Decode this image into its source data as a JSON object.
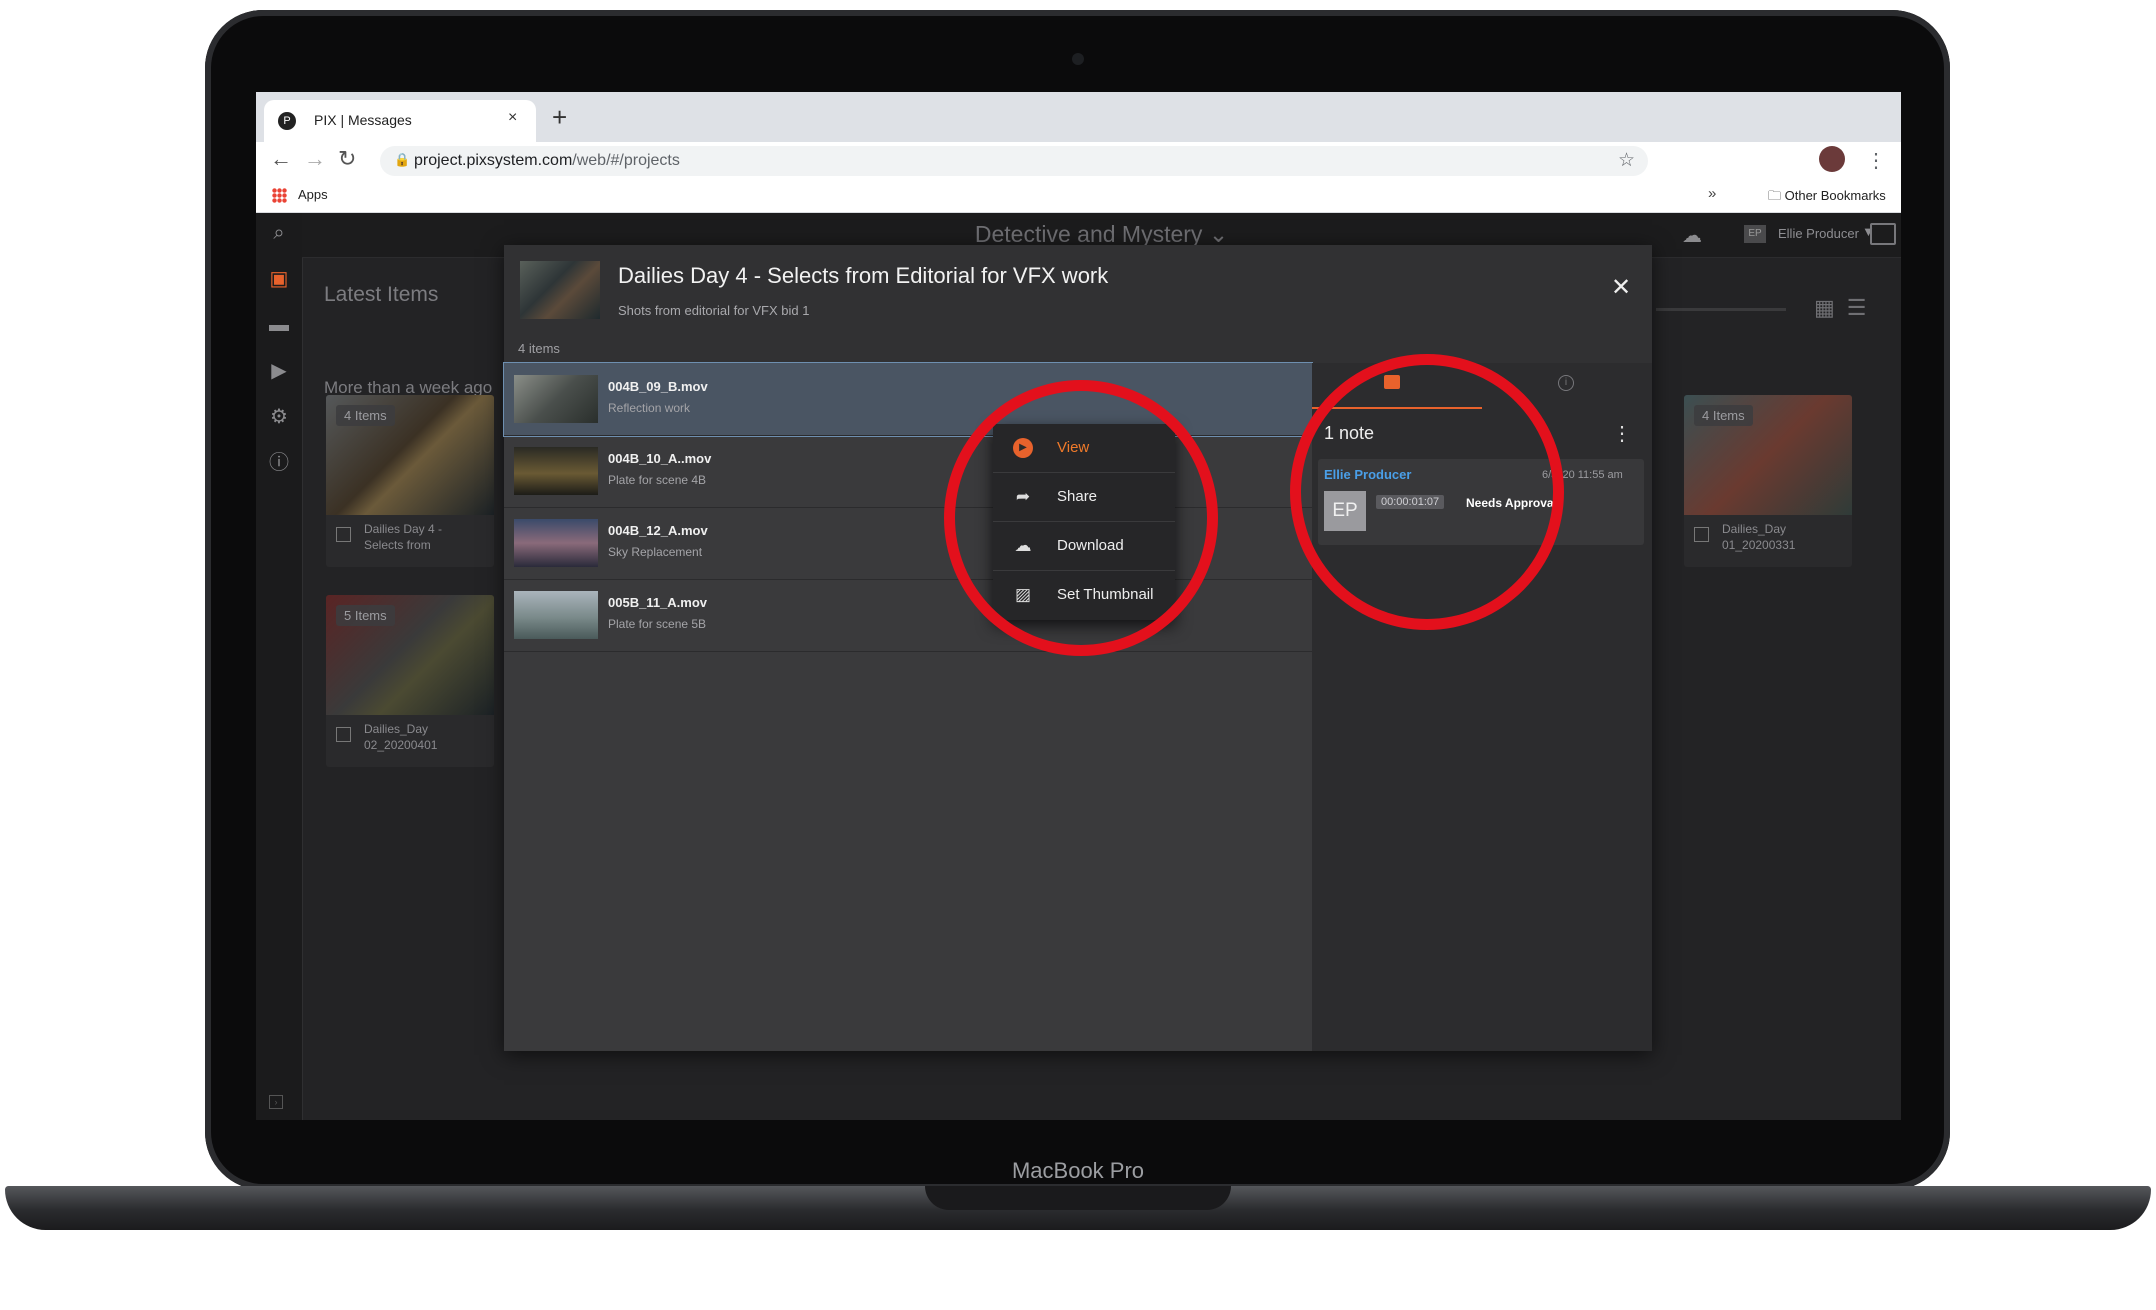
{
  "device": {
    "model_label": "MacBook Pro"
  },
  "browser": {
    "tab_title": "PIX | Messages",
    "tab_close": "×",
    "new_tab": "+",
    "url_host": "project.pixsystem.com",
    "url_path": "/web/#/projects",
    "bookmark_apps": "Apps",
    "bookmark_more": "»",
    "bookmark_other": "Other Bookmarks"
  },
  "app": {
    "project_title": "Detective and Mystery",
    "project_caret": "⌄",
    "user_initials": "EP",
    "user_name": "Ellie Producer",
    "user_caret": "▼",
    "section_title": "Latest Items",
    "group_title": "More than a week ago",
    "cards": [
      {
        "badge": "4 Items",
        "label": "Dailies Day 4 - Selects from"
      },
      {
        "badge": "5 Items",
        "label": "Dailies_Day 02_20200401"
      },
      {
        "badge": "4 Items",
        "label": "Dailies_Day 01_20200331"
      }
    ]
  },
  "modal": {
    "title": "Dailies Day 4 - Selects from Editorial for VFX work",
    "subtitle": "Shots from editorial for VFX bid 1",
    "close": "✕",
    "items_count": "4 items",
    "items": [
      {
        "name": "004B_09_B.mov",
        "desc": "Reflection work"
      },
      {
        "name": "004B_10_A..mov",
        "desc": "Plate for scene 4B"
      },
      {
        "name": "004B_12_A.mov",
        "desc": "Sky Replacement"
      },
      {
        "name": "005B_11_A.mov",
        "desc": "Plate for scene 5B"
      }
    ]
  },
  "context_menu": {
    "items": [
      {
        "label": "View",
        "icon": "play-icon"
      },
      {
        "label": "Share",
        "icon": "share-arrow-icon"
      },
      {
        "label": "Download",
        "icon": "cloud-download-icon"
      },
      {
        "label": "Set Thumbnail",
        "icon": "image-icon"
      }
    ]
  },
  "notes_panel": {
    "count_label": "1 note",
    "kebab": "⋮",
    "note": {
      "author": "Ellie Producer",
      "time": "6/3 '20 11:55 am",
      "avatar": "EP",
      "timecode": "00:00:01:07",
      "status": "Needs Approval"
    }
  },
  "colors": {
    "accent": "#e8622c",
    "annotation": "#e3101c",
    "author_link": "#4a9fe8"
  }
}
